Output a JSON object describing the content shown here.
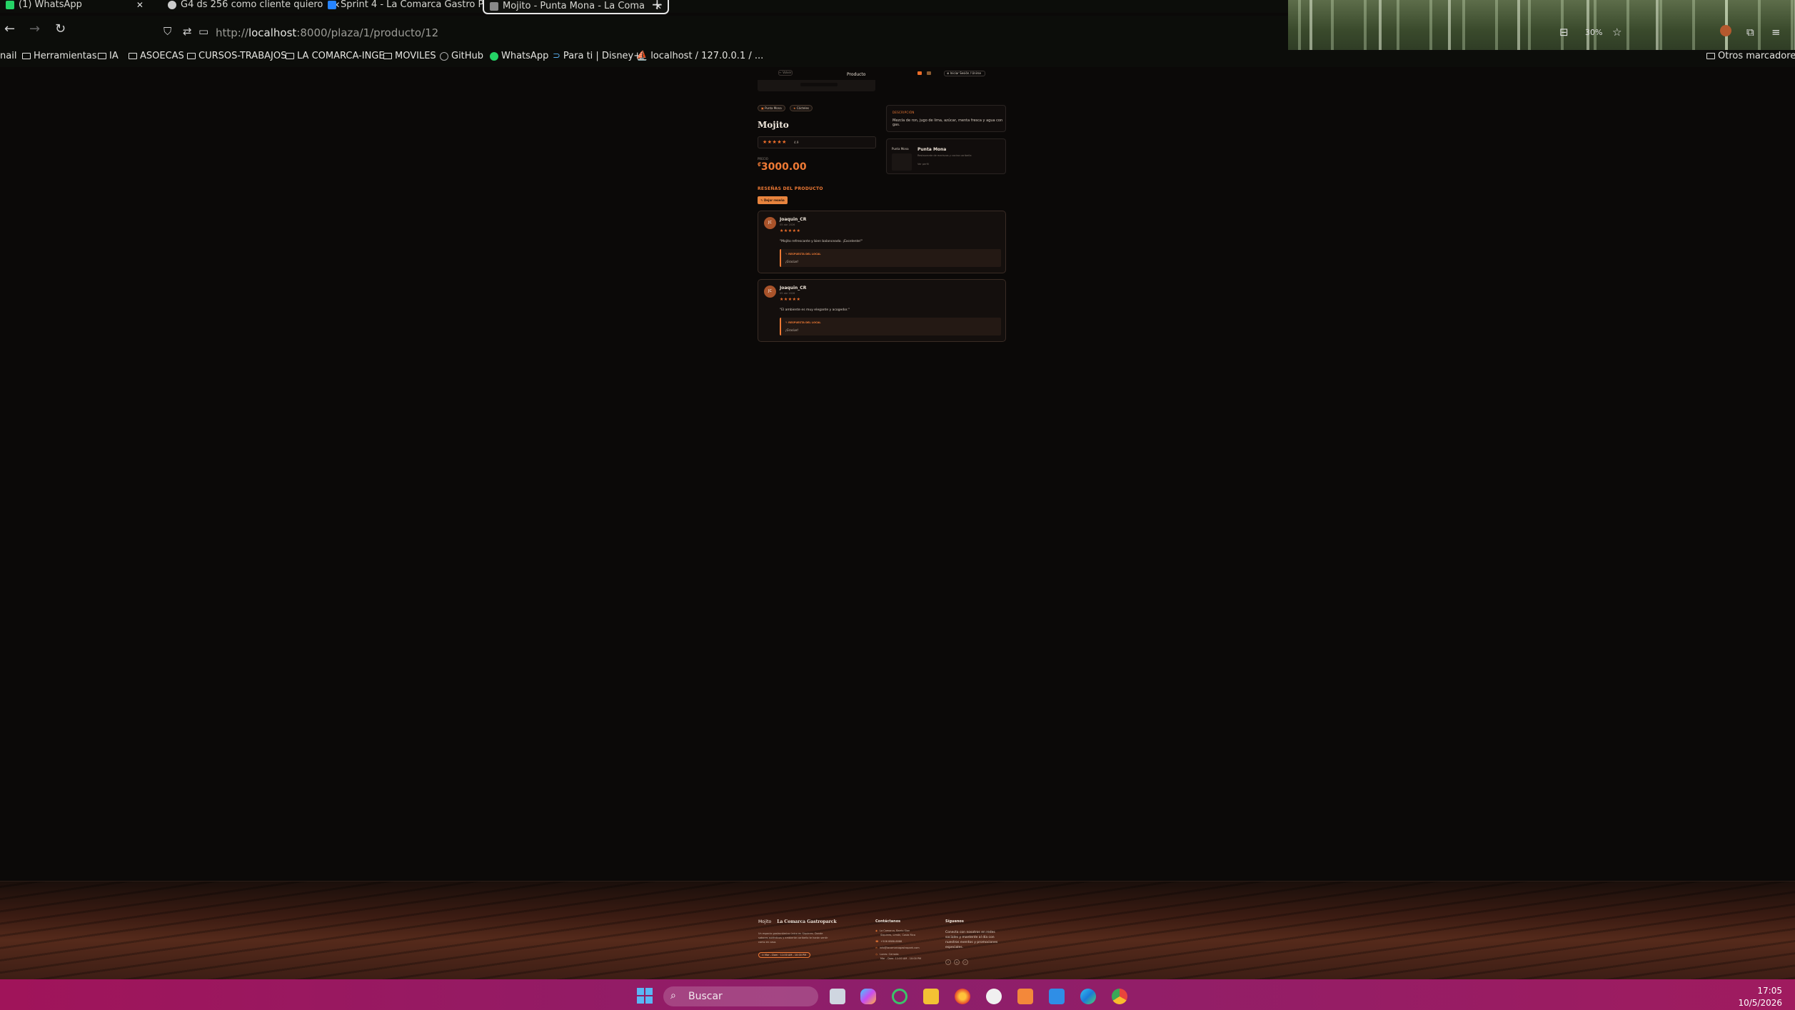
{
  "browser": {
    "tabs": [
      {
        "label": "(1) WhatsApp",
        "icon": "whatsapp-icon",
        "color": "#25d366"
      },
      {
        "label": "G4 ds 256 como cliente quiero",
        "icon": "github-icon",
        "color": "#cccccc"
      },
      {
        "label": "Sprint 4 - La Comarca Gastro Pl",
        "icon": "jira-icon",
        "color": "#2684ff"
      },
      {
        "label": "Mojito - Punta Mona - La Coma",
        "icon": "page-icon",
        "color": "#888888"
      }
    ],
    "url_prefix": "http://",
    "url_host": "localhost",
    "url_rest": ":8000/plaza/1/producto/12",
    "zoom": "30%",
    "bookmarks": [
      {
        "label": "nail",
        "type": "text"
      },
      {
        "label": "Herramientas",
        "type": "folder"
      },
      {
        "label": "IA",
        "type": "folder"
      },
      {
        "label": "ASOECAS",
        "type": "folder"
      },
      {
        "label": "CURSOS-TRABAJOS",
        "type": "folder"
      },
      {
        "label": "LA COMARCA-INGE",
        "type": "folder"
      },
      {
        "label": "MOVILES",
        "type": "folder"
      },
      {
        "label": "GitHub",
        "type": "github"
      },
      {
        "label": "WhatsApp",
        "type": "whatsapp"
      },
      {
        "label": "Para ti | Disney+",
        "type": "disney"
      },
      {
        "label": "localhost / 127.0.0.1 / ...",
        "type": "pma"
      }
    ],
    "other_bookmarks": "Otros marcadores"
  },
  "page": {
    "header": {
      "back_label": "← Volver",
      "title": "Producto",
      "cta_label": "⊕ Iniciar Sesión / Unirse"
    },
    "chips": [
      {
        "icon": "▣",
        "label": "Punta Mona"
      },
      {
        "icon": "★",
        "label": "Cócteles"
      }
    ],
    "product_name": "Mojito",
    "rating_stars": "★★★★★",
    "rating_count": "4.9",
    "price_label": "PRECIO",
    "price_currency": "₡",
    "price": "3000.00",
    "description_title": "DESCRIPCIÓN",
    "description": "Mezcla de ron, jugo de lima, azúcar, menta fresca y agua con gas.",
    "location": {
      "logo_text": "Punta Mona",
      "name": "Punta Mona",
      "subtitle": "Restaurante de mariscos y cocina caribeña",
      "phone": "Ver perfil"
    },
    "reviews_title": "RESEÑAS DEL PRODUCTO",
    "write_review_label": "✎ Dejar reseña",
    "reviews": [
      {
        "avatar": "JC",
        "user": "Joaquin_CR",
        "date": "05 abr 2026",
        "stars": "★★★★★",
        "text": "\"Mojito refrescante y bien balanceado. ¡Excelente!\"",
        "reply_title": "✎ RESPUESTA DEL LOCAL",
        "reply_text": "¡Gracias!"
      },
      {
        "avatar": "JC",
        "user": "Joaquin_CR",
        "date": "05 abr 2026",
        "stars": "★★★★★",
        "text": "\"El ambiente es muy elegante y acogedor.\"",
        "reply_title": "✎ RESPUESTA DEL LOCAL",
        "reply_text": "¡Gracias!"
      }
    ]
  },
  "footer": {
    "logo": "Mojito",
    "brand": "La Comarca Gastroparck",
    "about": "Un espacio gastronómico único en Siquirres. Donde sabores auténticos y ambiente caribeño te harán sentir como en casa.",
    "hours": "⊙ Mar - Dom · 11:00 AM - 10:00 PM",
    "contact_title": "Contáctanos",
    "contact_lines": [
      {
        "icon": "◉",
        "text": "La Comarca, Barrio Sion"
      },
      {
        "icon": "",
        "text": "Siquirres, Limón, Costa Rica"
      },
      {
        "icon": "☎",
        "text": "+506 8888-8888"
      },
      {
        "icon": "✉",
        "text": "info@lacomarcagastropark.com"
      },
      {
        "icon": "◷",
        "text": "Lunes: Cerrado"
      },
      {
        "icon": "",
        "text": "Mar - Dom: 11:00 AM - 10:00 PM"
      }
    ],
    "follow_title": "Síguenos",
    "follow_text": "Conecta con nosotros en redes sociales y mantente al día con nuestros eventos y promociones especiales.",
    "social": [
      "f",
      "◎",
      "♪"
    ]
  },
  "taskbar": {
    "search_label": "Buscar",
    "time": "17:05",
    "date": "10/5/2026"
  },
  "colors": {
    "accent": "#ef7a35",
    "background": "#0b0908",
    "taskbar": "#9b1660"
  }
}
